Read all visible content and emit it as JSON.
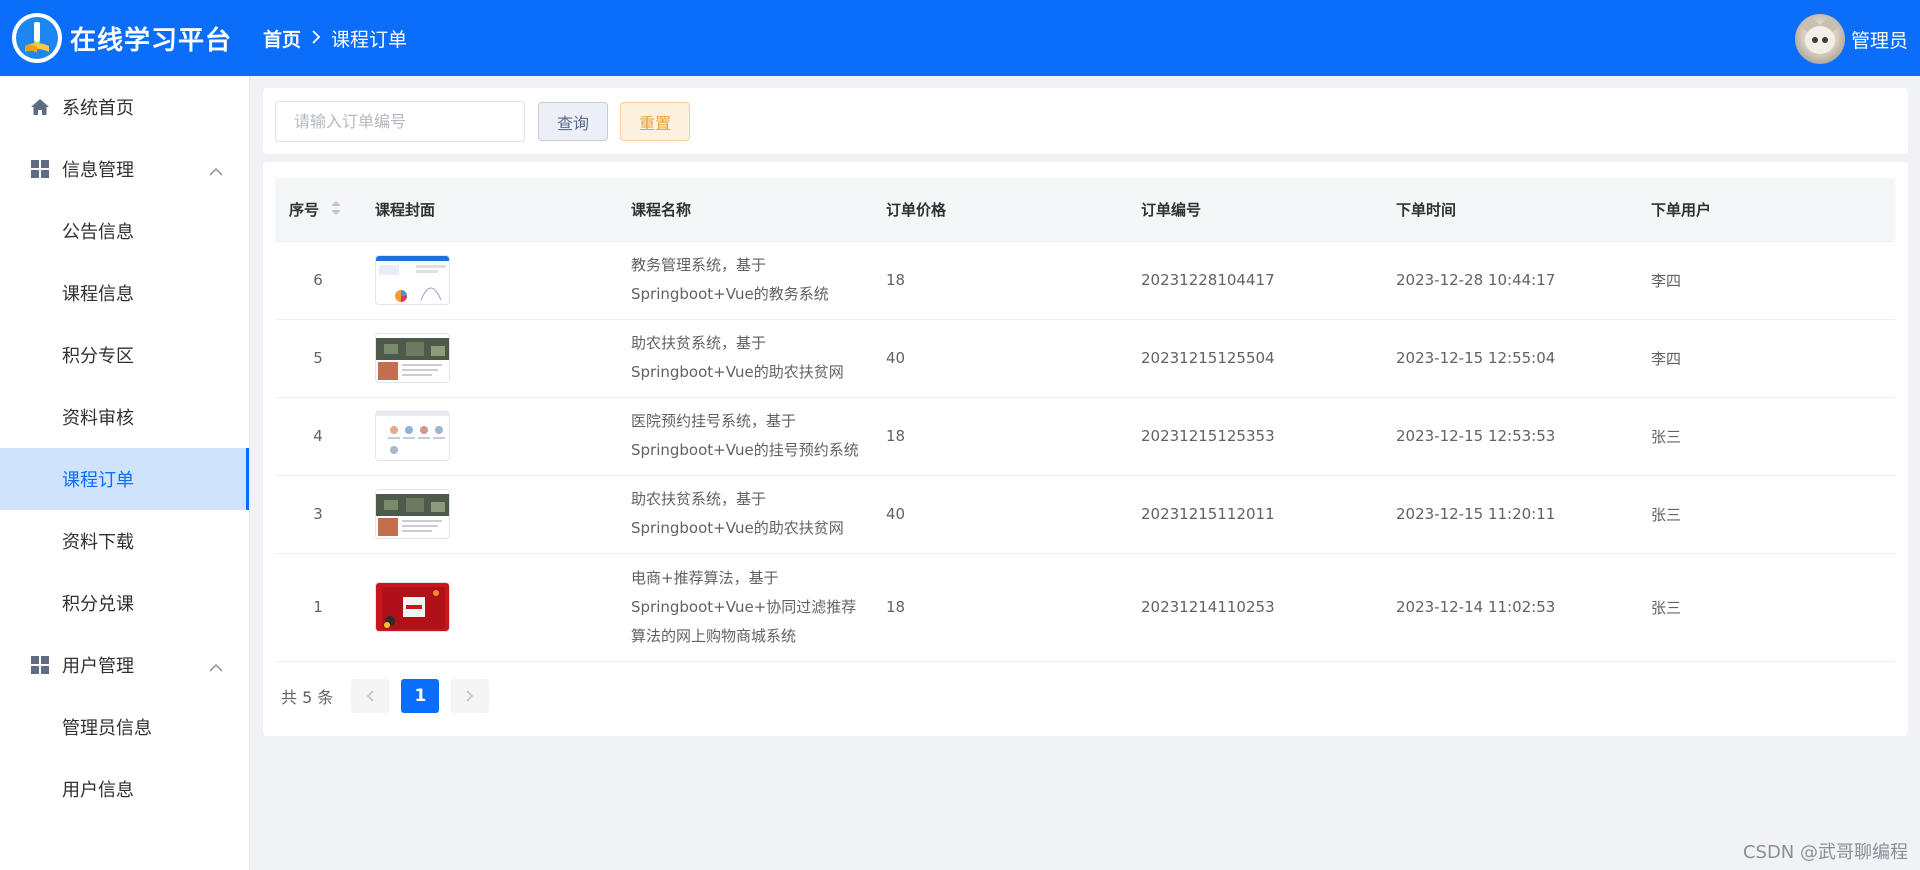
{
  "header": {
    "brand": "在线学习平台",
    "breadcrumb": {
      "home": "首页",
      "current": "课程订单"
    },
    "user_name": "管理员",
    "bg_color": "#0a6efa"
  },
  "sidebar": {
    "items": [
      {
        "label": "系统首页",
        "icon": "home-icon",
        "type": "top"
      },
      {
        "label": "信息管理",
        "icon": "grid-icon",
        "type": "group"
      },
      {
        "label": "公告信息",
        "type": "sub"
      },
      {
        "label": "课程信息",
        "type": "sub"
      },
      {
        "label": "积分专区",
        "type": "sub"
      },
      {
        "label": "资料审核",
        "type": "sub"
      },
      {
        "label": "课程订单",
        "type": "sub",
        "active": true
      },
      {
        "label": "资料下载",
        "type": "sub"
      },
      {
        "label": "积分兑课",
        "type": "sub"
      },
      {
        "label": "用户管理",
        "icon": "grid-icon",
        "type": "group"
      },
      {
        "label": "管理员信息",
        "type": "sub"
      },
      {
        "label": "用户信息",
        "type": "sub"
      }
    ]
  },
  "search": {
    "placeholder": "请输入订单编号",
    "query_label": "查询",
    "reset_label": "重置"
  },
  "table": {
    "columns": [
      "序号",
      "课程封面",
      "课程名称",
      "订单价格",
      "订单编号",
      "下单时间",
      "下单用户"
    ],
    "rows": [
      {
        "index": "6",
        "cover": "dashboard-screenshot",
        "name": "教务管理系统，基于Springboot+Vue的教务系统",
        "price": "18",
        "order_no": "20231228104417",
        "time": "2023-12-28 10:44:17",
        "user": "李四"
      },
      {
        "index": "5",
        "cover": "landscape-screenshot",
        "name": "助农扶贫系统，基于Springboot+Vue的助农扶贫网",
        "price": "40",
        "order_no": "20231215125504",
        "time": "2023-12-15 12:55:04",
        "user": "李四"
      },
      {
        "index": "4",
        "cover": "grid-screenshot",
        "name": "医院预约挂号系统，基于Springboot+Vue的挂号预约系统",
        "price": "18",
        "order_no": "20231215125353",
        "time": "2023-12-15 12:53:53",
        "user": "张三"
      },
      {
        "index": "3",
        "cover": "landscape-screenshot",
        "name": "助农扶贫系统，基于Springboot+Vue的助农扶贫网",
        "price": "40",
        "order_no": "20231215112011",
        "time": "2023-12-15 11:20:11",
        "user": "张三"
      },
      {
        "index": "1",
        "cover": "red-banner-screenshot",
        "name": "电商+推荐算法，基于Springboot+Vue+协同过滤推荐算法的网上购物商城系统",
        "price": "18",
        "order_no": "20231214110253",
        "time": "2023-12-14 11:02:53",
        "user": "张三"
      }
    ]
  },
  "pagination": {
    "total_text": "共 5 条",
    "current_page": "1",
    "prev_icon": "chevron-left-icon",
    "next_icon": "chevron-right-icon"
  },
  "watermark": "CSDN @武哥聊编程"
}
